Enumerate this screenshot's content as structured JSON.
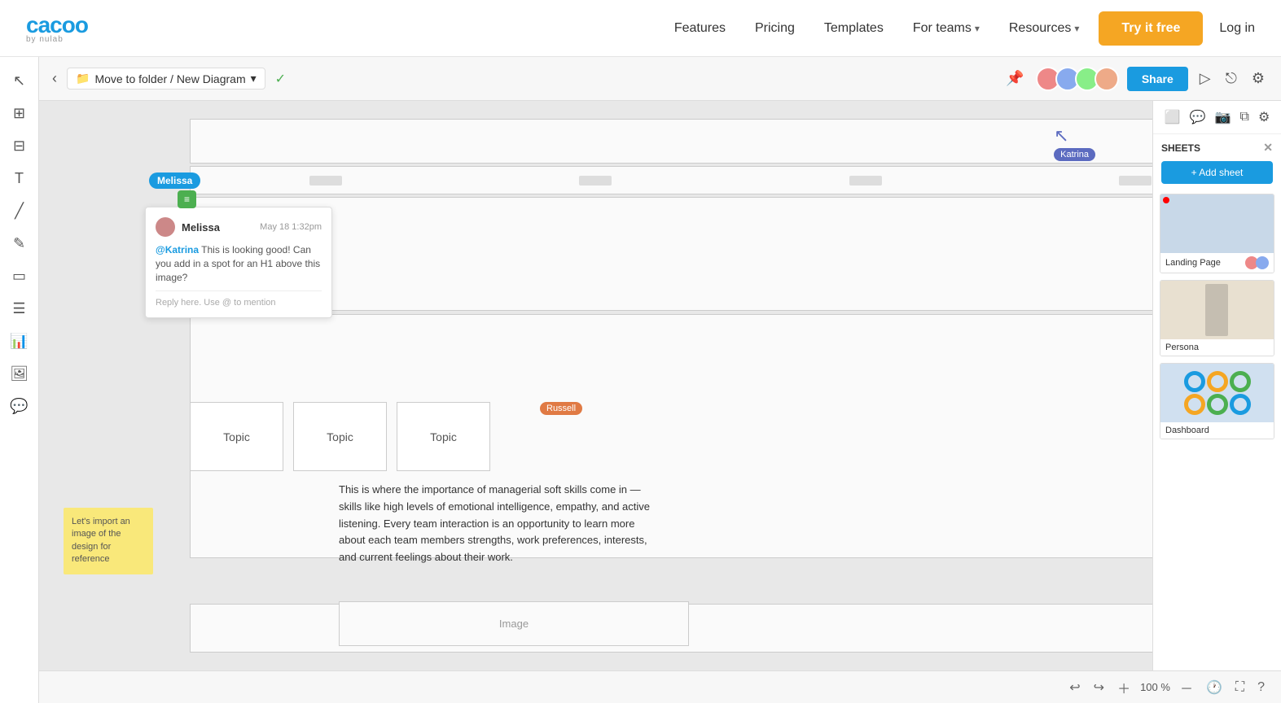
{
  "nav": {
    "logo": "cacoo",
    "logo_sub": "by nulab",
    "links": [
      {
        "label": "Features",
        "has_dropdown": false
      },
      {
        "label": "Pricing",
        "has_dropdown": false
      },
      {
        "label": "Templates",
        "has_dropdown": false
      },
      {
        "label": "For teams",
        "has_dropdown": true
      },
      {
        "label": "Resources",
        "has_dropdown": true
      }
    ],
    "try_free": "Try it free",
    "login": "Log in"
  },
  "canvas": {
    "back_label": "‹",
    "folder_label": "Move to folder / New Diagram",
    "folder_icon": "📁",
    "check_icon": "✓",
    "share_btn": "Share"
  },
  "comment": {
    "author_tag": "Melissa",
    "sticky_icon": "≡",
    "name": "Melissa",
    "time": "May 18 1:32pm",
    "text_mention": "@Katrina",
    "text_body": " This is looking good! Can you add in a spot for an H1 above this image?",
    "reply_placeholder": "Reply here. Use @ to mention"
  },
  "cursors": {
    "katrina": "Katrina",
    "russell": "Russell"
  },
  "diagram": {
    "topics": [
      "Topic",
      "Topic",
      "Topic"
    ],
    "body_text": "This is where the importance of managerial soft skills come in — skills like high levels of emotional intelligence, empathy, and active listening. Every team interaction is an opportunity to learn more about each team members strengths, work preferences, interests, and current feelings about their work.",
    "sticky_note": "Let's import an image of the design for reference",
    "image_placeholder": "Image"
  },
  "right_panel": {
    "sheets_title": "SHEETS",
    "add_sheet": "+ Add sheet",
    "sheets": [
      {
        "label": "Landing Page",
        "type": "landing"
      },
      {
        "label": "Persona",
        "type": "persona"
      },
      {
        "label": "Dashboard",
        "type": "dashboard"
      }
    ]
  },
  "bottom_bar": {
    "zoom": "100 %"
  }
}
